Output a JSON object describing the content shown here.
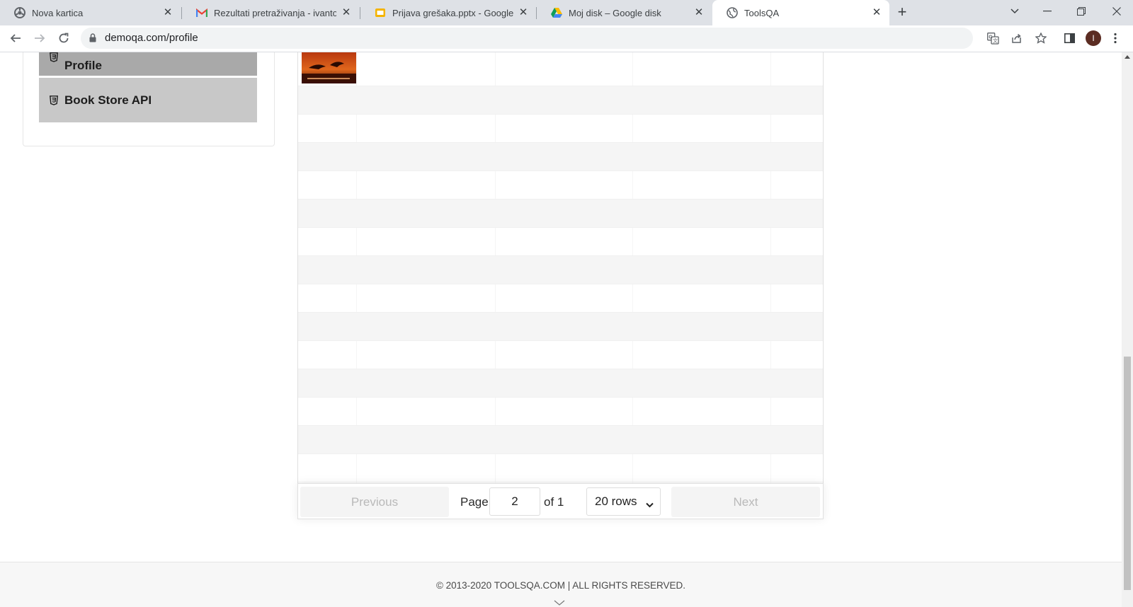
{
  "browser": {
    "tabs": [
      {
        "title": "Nova kartica",
        "icon": "chrome-icon"
      },
      {
        "title": "Rezultati pretraživanja - ivantoma",
        "icon": "gmail-icon"
      },
      {
        "title": "Prijava grešaka.pptx - Google pre",
        "icon": "slides-icon"
      },
      {
        "title": "Moj disk – Google disk",
        "icon": "drive-icon"
      },
      {
        "title": "ToolsQA",
        "icon": "globe-icon",
        "active": true
      }
    ],
    "url": "demoqa.com/profile",
    "avatar_initial": "I"
  },
  "sidebar": {
    "items": [
      {
        "label": "Profile",
        "active": true
      },
      {
        "label": "Book Store API",
        "active": false
      }
    ]
  },
  "table": {
    "visible_rows": 15,
    "first_row_has_book_image": true
  },
  "pagination": {
    "previous_label": "Previous",
    "page_label": "Page",
    "page_value": "2",
    "of_label": "of 1",
    "rows_selected": "20 rows",
    "next_label": "Next"
  },
  "footer": {
    "copyright": "© 2013-2020 TOOLSQA.COM | ALL RIGHTS RESERVED."
  },
  "colors": {
    "menu_active": "#a9a9a9",
    "menu_item": "#c8c8c8",
    "row_stripe": "#f5f5f5"
  }
}
